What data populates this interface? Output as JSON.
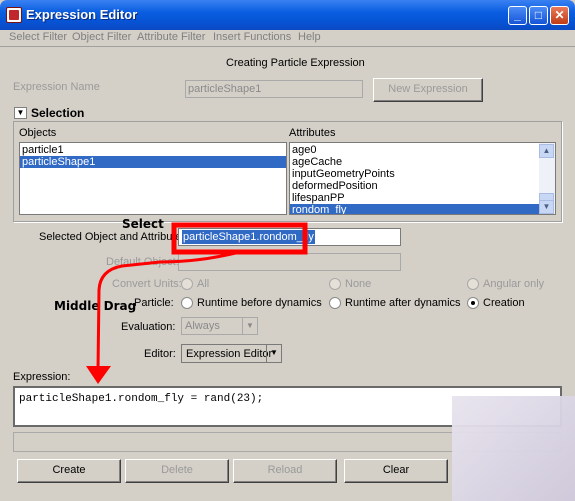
{
  "window": {
    "title": "Expression Editor",
    "minimize": "_",
    "maximize": "□",
    "close": "✕"
  },
  "menu": [
    "Select Filter",
    "Object Filter",
    "Attribute Filter",
    "Insert Functions",
    "Help"
  ],
  "header": {
    "mode_title": "Creating Particle Expression"
  },
  "expression_name": {
    "label": "Expression Name",
    "value": "particleShape1",
    "new_button": "New Expression"
  },
  "selection": {
    "toggle_glyph": "▼",
    "title": "Selection",
    "objects_label": "Objects",
    "objects": [
      "particle1",
      "particleShape1"
    ],
    "objects_selected_index": 1,
    "attributes_label": "Attributes",
    "attributes": [
      "age0",
      "ageCache",
      "inputGeometryPoints",
      "deformedPosition",
      "lifespanPP",
      "rondom_fly"
    ],
    "attributes_selected_index": 5
  },
  "selected_attr": {
    "label": "Selected Object and Attribute:",
    "value": "particleShape1.rondom_fly"
  },
  "default_object": {
    "label": "Default Object:"
  },
  "convert_units": {
    "label": "Convert Units:",
    "options": [
      "All",
      "None",
      "Angular only"
    ],
    "selected": "All"
  },
  "particle": {
    "label": "Particle:",
    "options": [
      "Runtime before dynamics",
      "Runtime after dynamics",
      "Creation"
    ],
    "selected": "Creation"
  },
  "evaluation": {
    "label": "Evaluation:",
    "value": "Always"
  },
  "editor": {
    "label": "Editor:",
    "value": "Expression Editor"
  },
  "expression": {
    "label": "Expression:",
    "code": "particleShape1.rondom_fly = rand(23);"
  },
  "buttons": {
    "create": "Create",
    "delete": "Delete",
    "reload": "Reload",
    "clear": "Clear"
  },
  "annotations": {
    "select": "Select",
    "middle_drag": "Middle Drag"
  },
  "colors": {
    "annotation_red": "#ff0000",
    "selection_blue": "#316ac5",
    "titlebar_blue": "#0a5ee0"
  }
}
